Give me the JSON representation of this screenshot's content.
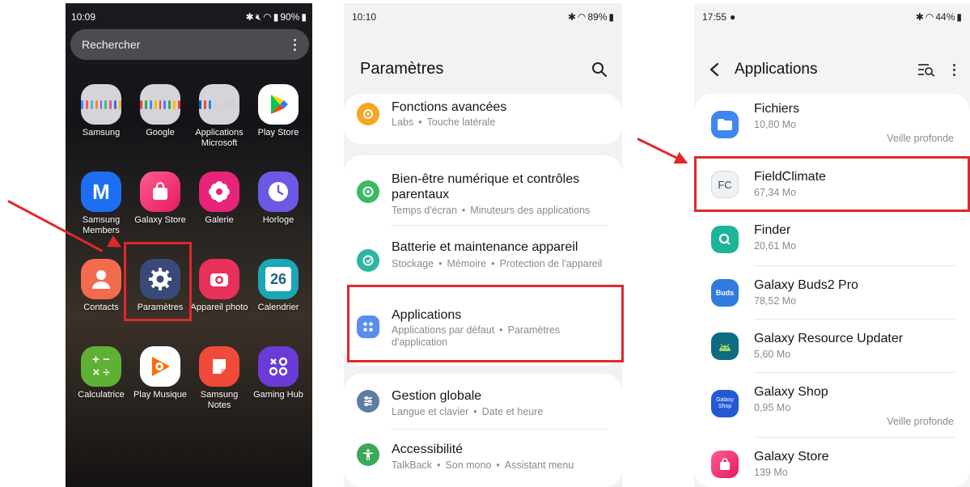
{
  "phone1": {
    "status": {
      "time": "10:09",
      "battery": "90%"
    },
    "search": {
      "placeholder": "Rechercher"
    },
    "apps": [
      {
        "label": "Samsung",
        "icon": "samsung-folder-icon"
      },
      {
        "label": "Google",
        "icon": "google-folder-icon"
      },
      {
        "label": "Applications Microsoft",
        "icon": "microsoft-folder-icon"
      },
      {
        "label": "Play Store",
        "icon": "play-store-icon"
      },
      {
        "label": "Samsung Members",
        "icon": "samsung-members-icon"
      },
      {
        "label": "Galaxy Store",
        "icon": "galaxy-store-icon"
      },
      {
        "label": "Galerie",
        "icon": "gallery-flower-icon"
      },
      {
        "label": "Horloge",
        "icon": "clock-icon"
      },
      {
        "label": "Contacts",
        "icon": "contacts-icon"
      },
      {
        "label": "Paramètres",
        "icon": "settings-gear-icon"
      },
      {
        "label": "Appareil photo",
        "icon": "camera-icon"
      },
      {
        "label": "Calendrier",
        "icon": "calendar-icon",
        "badge": "26"
      },
      {
        "label": "Calculatrice",
        "icon": "calculator-icon"
      },
      {
        "label": "Play Musique",
        "icon": "play-music-icon"
      },
      {
        "label": "Samsung Notes",
        "icon": "notes-icon"
      },
      {
        "label": "Gaming Hub",
        "icon": "gaming-hub-icon"
      }
    ]
  },
  "phone2": {
    "status": {
      "time": "10:10",
      "battery": "89%"
    },
    "title": "Paramètres",
    "items": [
      {
        "title": "Fonctions avancées",
        "subs": [
          "Labs",
          "Touche latérale"
        ],
        "icon": "advanced-features-icon",
        "color": "#f5a623"
      },
      {
        "title": "Bien-être numérique et contrôles parentaux",
        "subs": [
          "Temps d'écran",
          "Minuteurs des applications"
        ],
        "icon": "digital-wellbeing-icon",
        "color": "#3cb868"
      },
      {
        "title": "Batterie et maintenance appareil",
        "subs": [
          "Stockage",
          "Mémoire",
          "Protection de l'appareil"
        ],
        "icon": "battery-care-icon",
        "color": "#2bb6a0"
      },
      {
        "title": "Applications",
        "subs": [
          "Applications par défaut",
          "Paramètres d'application"
        ],
        "icon": "apps-grid-icon",
        "color": "#5b8def"
      },
      {
        "title": "Gestion globale",
        "subs": [
          "Langue et clavier",
          "Date et heure"
        ],
        "icon": "general-management-icon",
        "color": "#5f7d9e"
      },
      {
        "title": "Accessibilité",
        "subs": [
          "TalkBack",
          "Son mono",
          "Assistant menu"
        ],
        "icon": "accessibility-icon",
        "color": "#3aa856"
      }
    ]
  },
  "phone3": {
    "status": {
      "time": "17:55",
      "battery": "44%"
    },
    "title": "Applications",
    "apps": [
      {
        "name": "Fichiers",
        "size": "10,80 Mo",
        "badge": "Veille profonde",
        "icon": "files-folder-icon",
        "color": "#3f86f0"
      },
      {
        "name": "FieldClimate",
        "size": "67,34 Mo",
        "badge": "",
        "icon": "fieldclimate-icon",
        "color": "#eef2f4"
      },
      {
        "name": "Finder",
        "size": "20,61 Mo",
        "badge": "",
        "icon": "finder-search-icon",
        "color": "#1db598"
      },
      {
        "name": "Galaxy Buds2 Pro",
        "size": "78,52 Mo",
        "badge": "",
        "icon": "buds-icon",
        "color": "#2f7be0"
      },
      {
        "name": "Galaxy Resource Updater",
        "size": "5,60 Mo",
        "badge": "",
        "icon": "android-updater-icon",
        "color": "#0e6b82"
      },
      {
        "name": "Galaxy Shop",
        "size": "0,95 Mo",
        "badge": "Veille profonde",
        "icon": "galaxy-shop-icon",
        "color": "#2459d6"
      },
      {
        "name": "Galaxy Store",
        "size": "139 Mo",
        "badge": "",
        "icon": "galaxy-store-bag-icon",
        "color": "#ef3a7b"
      }
    ]
  },
  "icon_text": {
    "fc_mark": "FC",
    "buds_mark": "Buds",
    "shop_mark": "Galaxy Shop",
    "calendar_day": "26",
    "calc_mark": "+ −\n× ÷",
    "members_mark": "M"
  }
}
